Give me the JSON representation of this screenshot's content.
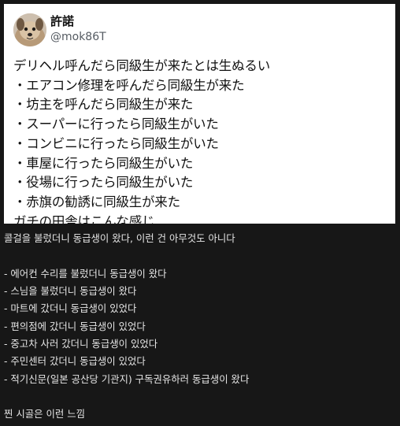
{
  "tweet": {
    "display_name": "許諾",
    "handle": "@mok86T",
    "avatar_icon": "dog-avatar-icon",
    "lines": [
      "デリヘル呼んだら同級生が来たとは生ぬるい",
      "・エアコン修理を呼んだら同級生が来た",
      "・坊主を呼んだら同級生が来た",
      "・スーパーに行ったら同級生がいた",
      "・コンビニに行ったら同級生がいた",
      "・車屋に行ったら同級生がいた",
      "・役場に行ったら同級生がいた",
      "・赤旗の勧誘に同級生が来た",
      "ガチの田舎はこんな感じ"
    ]
  },
  "translation": {
    "lines": [
      "콜걸을 불렀더니 동급생이 왔다, 이런 건 아무것도 아니다",
      "",
      "- 에어컨 수리를 불렀더니 동급생이 왔다",
      "- 스님을 불렀더니 동급생이 왔다",
      "- 마트에 갔더니 동급생이 있었다",
      "- 편의점에 갔더니 동급생이 있었다",
      "- 중고차 사러 갔더니 동급생이 있었다",
      "- 주민센터 갔더니 동급생이 있었다",
      "- 적기신문(일본 공산당 기관지) 구독권유하러 동급생이 왔다",
      "",
      "찐 시골은 이런 느낌"
    ]
  }
}
